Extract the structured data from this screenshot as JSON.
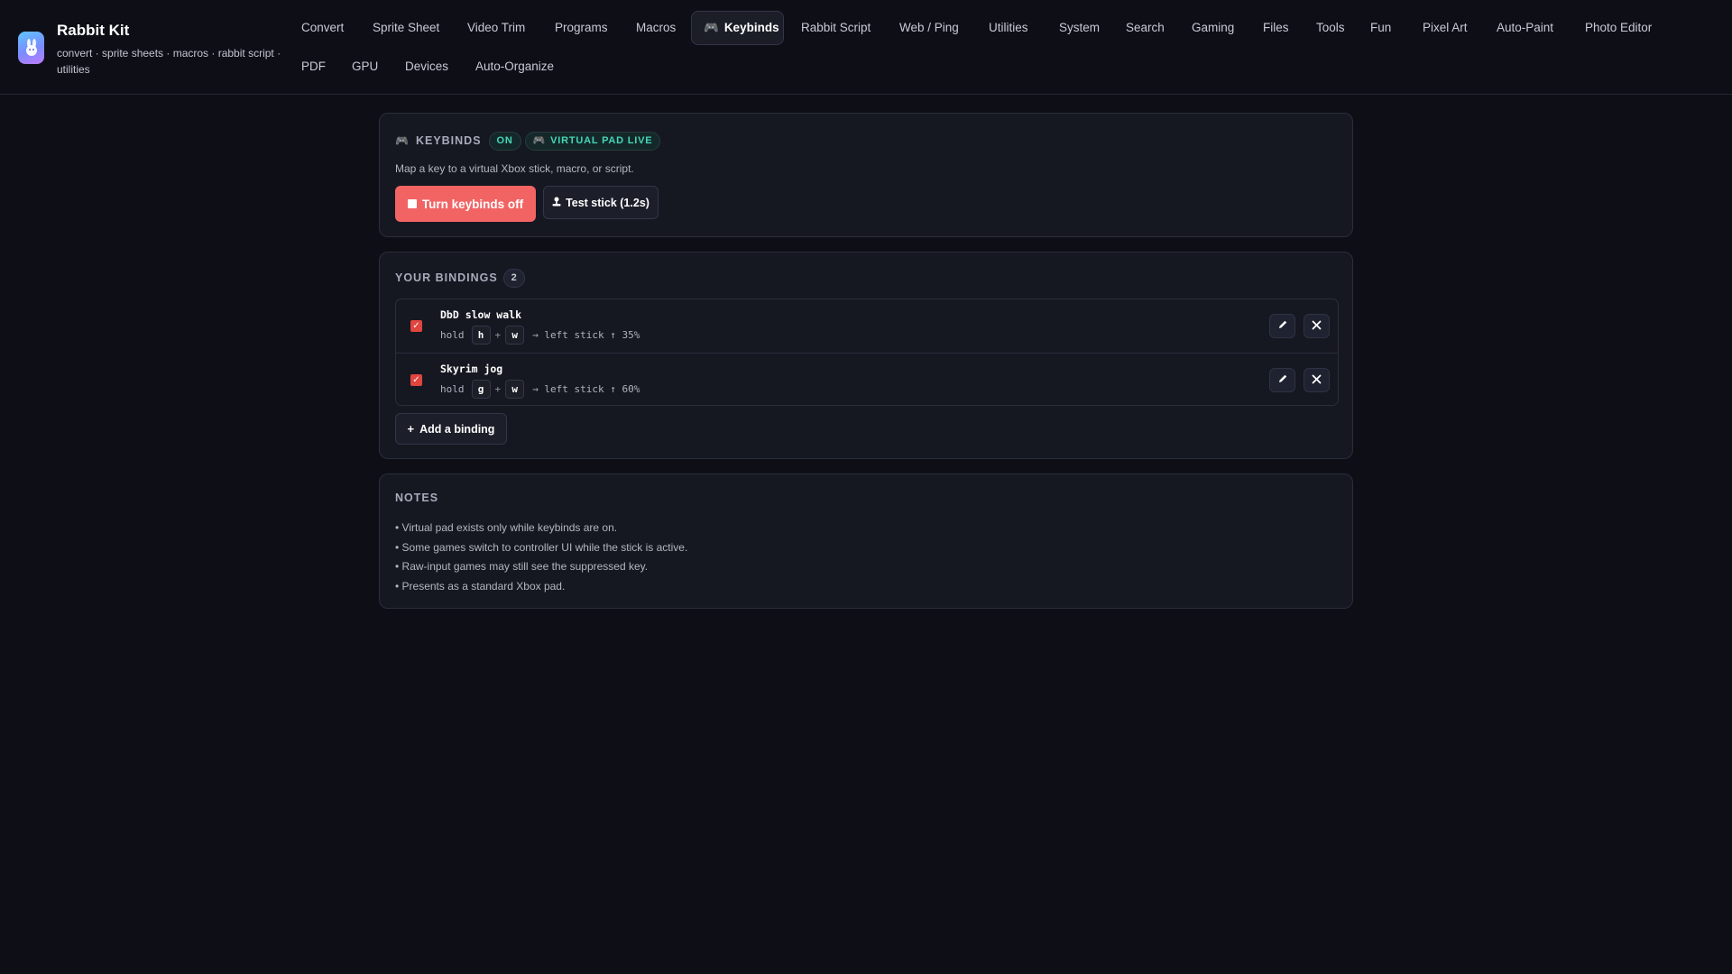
{
  "app": {
    "title": "Rabbit Kit",
    "subtitle": "convert · sprite sheets · macros · rabbit script · utilities"
  },
  "nav": {
    "items": [
      {
        "label": "Convert"
      },
      {
        "label": "Sprite Sheet"
      },
      {
        "label": "Video Trim"
      },
      {
        "label": "Programs"
      },
      {
        "label": "Macros"
      },
      {
        "label": "Keybinds",
        "active": true,
        "icon": "gamepad-icon"
      },
      {
        "label": "Rabbit Script"
      },
      {
        "label": "Web / Ping"
      },
      {
        "label": "Utilities"
      },
      {
        "label": "System"
      },
      {
        "label": "Search"
      },
      {
        "label": "Gaming"
      },
      {
        "label": "Files"
      },
      {
        "label": "Tools"
      },
      {
        "label": "Fun"
      },
      {
        "label": "Pixel Art"
      },
      {
        "label": "Auto-Paint"
      },
      {
        "label": "Photo Editor"
      },
      {
        "label": "PDF"
      },
      {
        "label": "GPU"
      },
      {
        "label": "Devices"
      },
      {
        "label": "Auto-Organize"
      }
    ]
  },
  "keybinds": {
    "title": "KEYBINDS",
    "status": "ON",
    "pad_status": "VIRTUAL PAD LIVE",
    "description": "Map a key to a virtual Xbox stick, macro, or script.",
    "turn_off_label": "Turn keybinds off",
    "test_label": "Test stick (1.2s)"
  },
  "bindings": {
    "title": "YOUR BINDINGS",
    "count": "2",
    "items": [
      {
        "enabled": true,
        "name": "DbD slow walk",
        "hold": "hold",
        "key1": "h",
        "plus": "+",
        "key2": "w",
        "action": "→ left stick ↑ 35%"
      },
      {
        "enabled": true,
        "name": "Skyrim jog",
        "hold": "hold",
        "key1": "g",
        "plus": "+",
        "key2": "w",
        "action": "→ left stick ↑ 60%"
      }
    ],
    "add_label": "Add a binding"
  },
  "notes": {
    "title": "NOTES",
    "items": [
      "• Virtual pad exists only while keybinds are on.",
      "• Some games switch to controller UI while the stick is active.",
      "• Raw-input games may still see the suppressed key.",
      "• Presents as a standard Xbox pad."
    ]
  },
  "colors": {
    "accent_red": "#f26464",
    "status_green": "#45d7b6",
    "accent_purple": "#9b7bff",
    "background": "#0e0f16"
  }
}
